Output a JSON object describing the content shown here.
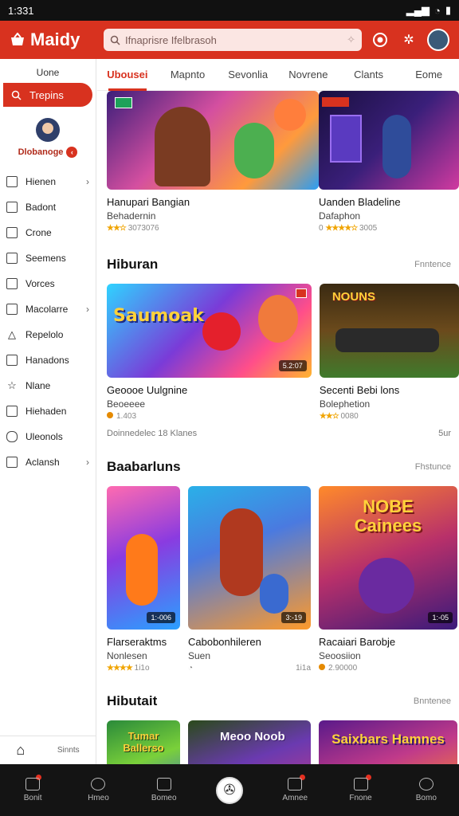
{
  "status": {
    "time": "1:331",
    "icons": [
      "signal-icon",
      "wifi-icon",
      "battery-icon"
    ]
  },
  "app": {
    "name": "Maidy",
    "search_placeholder": "Ifnaprisre Ifelbrasoh"
  },
  "sidebar": {
    "header": "Uone",
    "active_item": "Trepins",
    "profile_name": "Dlobanoge",
    "items": [
      {
        "label": "Hienen",
        "icon": "square-icon",
        "chevron": true
      },
      {
        "label": "Badont",
        "icon": "image-icon",
        "chevron": false
      },
      {
        "label": "Crone",
        "icon": "home-icon",
        "chevron": false
      },
      {
        "label": "Seemens",
        "icon": "doc-icon",
        "chevron": false
      },
      {
        "label": "Vorces",
        "icon": "edit-icon",
        "chevron": false
      },
      {
        "label": "Macolarre",
        "icon": "box-icon",
        "chevron": true
      },
      {
        "label": "Repelolo",
        "icon": "triangle-icon",
        "chevron": false
      },
      {
        "label": "Hanadons",
        "icon": "chat-icon",
        "chevron": false
      },
      {
        "label": "Nlane",
        "icon": "star-icon",
        "chevron": false
      },
      {
        "label": "Hiehaden",
        "icon": "book-icon",
        "chevron": false
      },
      {
        "label": "Uleonols",
        "icon": "tag-icon",
        "chevron": false
      },
      {
        "label": "Aclansh",
        "icon": "grid-icon",
        "chevron": true
      }
    ],
    "footer_label": "Sinnts"
  },
  "tabs": [
    "Ubousei",
    "Mapnto",
    "Sevonlia",
    "Novrene",
    "Clants",
    "Eome"
  ],
  "hero": [
    {
      "title": "Hanupari Bangian",
      "subtitle": "Behadernin",
      "rating": "★★☆",
      "meta": "3073076",
      "extra": ""
    },
    {
      "title": "Uanden Bladeline",
      "subtitle": "Dafaphon",
      "rating": "★★★★☆",
      "meta": "3005",
      "extra": "0"
    }
  ],
  "sections": [
    {
      "title": "Hiburan",
      "more": "Fnntence",
      "cards": [
        {
          "title": "Geoooe Uulgnine",
          "subtitle": "Beoeeee",
          "meta": "1.403",
          "chip": "5.2:07",
          "art": "Saumoak"
        },
        {
          "title": "Secenti Bebi lons",
          "subtitle": "Bolephetion",
          "meta": "0080",
          "chip": "",
          "art": "NOUNS"
        }
      ],
      "footnote_left": "Doinnedelec 18 Klanes",
      "footnote_right": "5ur"
    },
    {
      "title": "Baabarluns",
      "more": "Fhstunce",
      "cards": [
        {
          "title": "Flarseraktms",
          "subtitle": "Nonlesen",
          "meta": "1i1o",
          "chip": "1:-006",
          "art": ""
        },
        {
          "title": "Cabobonhileren",
          "subtitle": "Suen",
          "meta": "1i1a",
          "chip": "3:-19",
          "art": ""
        },
        {
          "title": "Racaiari Barobje",
          "subtitle": "Seoosiion",
          "meta": "2.90000",
          "chip": "1:-05",
          "art": "NOBE Cainees"
        }
      ]
    },
    {
      "title": "Hibutait",
      "more": "Bnntenee",
      "cards": [
        {
          "art": "Tumar Ballerso"
        },
        {
          "art": "Meoo Noob"
        },
        {
          "art": "Saixbars Hamnes"
        }
      ]
    }
  ],
  "bottom_nav": [
    "Bonit",
    "Hmeo",
    "Bomeo",
    "",
    "Amnee",
    "Fnone",
    "Bomo"
  ],
  "colors": {
    "primary": "#d8321f",
    "dark": "#141414"
  }
}
